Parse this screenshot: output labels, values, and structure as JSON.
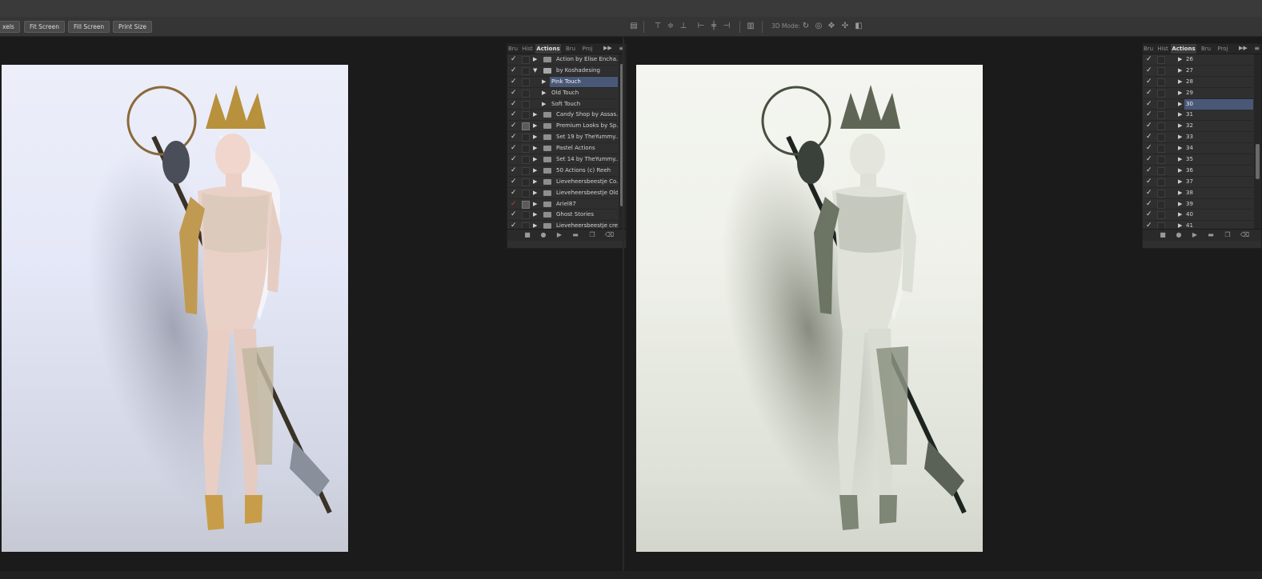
{
  "optionsbar": {
    "buttons": [
      "xels",
      "Fit Screen",
      "Fill Screen",
      "Print Size"
    ],
    "mode_label": "3D Mode:",
    "icons": [
      "auto-align-icon",
      "align-top-icon",
      "align-vcenter-icon",
      "align-bottom-icon",
      "align-left-icon",
      "align-hcenter-icon",
      "align-right-icon",
      "distribute-icon",
      "3d-rotate-icon",
      "3d-roll-icon",
      "3d-pan-icon",
      "3d-slide-icon",
      "3d-scale-icon"
    ]
  },
  "panel_left": {
    "tabs": [
      "Bru",
      "Hist",
      "Actions",
      "Bru",
      "Proj"
    ],
    "active_tab": "Actions",
    "rows": [
      {
        "label": "Action by Elise Encha...",
        "level": 0,
        "expanded": false,
        "folder": true,
        "check": "on",
        "dialog": false,
        "selected": false
      },
      {
        "label": "by Koshadesing",
        "level": 0,
        "expanded": true,
        "folder": true,
        "check": "on",
        "dialog": false,
        "selected": false
      },
      {
        "label": "Pink Touch",
        "level": 1,
        "expanded": false,
        "folder": false,
        "check": "on",
        "dialog": false,
        "selected": true
      },
      {
        "label": "Old Touch",
        "level": 1,
        "expanded": false,
        "folder": false,
        "check": "on",
        "dialog": false,
        "selected": false
      },
      {
        "label": "Soft Touch",
        "level": 1,
        "expanded": false,
        "folder": false,
        "check": "on",
        "dialog": false,
        "selected": false
      },
      {
        "label": "Candy Shop by Assas...",
        "level": 0,
        "expanded": false,
        "folder": true,
        "check": "on",
        "dialog": false,
        "selected": false
      },
      {
        "label": "Premium Looks by Sp...",
        "level": 0,
        "expanded": false,
        "folder": true,
        "check": "on",
        "dialog": true,
        "selected": false
      },
      {
        "label": "Set 19 by TheYummy...",
        "level": 0,
        "expanded": false,
        "folder": true,
        "check": "on",
        "dialog": false,
        "selected": false
      },
      {
        "label": "Pastel Actions",
        "level": 0,
        "expanded": false,
        "folder": true,
        "check": "on",
        "dialog": false,
        "selected": false
      },
      {
        "label": "Set 14 by TheYummy...",
        "level": 0,
        "expanded": false,
        "folder": true,
        "check": "on",
        "dialog": false,
        "selected": false
      },
      {
        "label": "50 Actions (c) Reeh",
        "level": 0,
        "expanded": false,
        "folder": true,
        "check": "on",
        "dialog": false,
        "selected": false
      },
      {
        "label": "Lieveheersbeestje Co...",
        "level": 0,
        "expanded": false,
        "folder": true,
        "check": "on",
        "dialog": false,
        "selected": false
      },
      {
        "label": "Lieveheersbeestje Old...",
        "level": 0,
        "expanded": false,
        "folder": true,
        "check": "on",
        "dialog": false,
        "selected": false
      },
      {
        "label": "Ariel87",
        "level": 0,
        "expanded": false,
        "folder": true,
        "check": "red",
        "dialog": true,
        "selected": false
      },
      {
        "label": "Ghost Stories",
        "level": 0,
        "expanded": false,
        "folder": true,
        "check": "on",
        "dialog": false,
        "selected": false
      },
      {
        "label": "Lieveheersbeestje cre...",
        "level": 0,
        "expanded": false,
        "folder": true,
        "check": "on",
        "dialog": false,
        "selected": false
      }
    ],
    "footer_icons": [
      "stop-icon",
      "record-icon",
      "play-icon",
      "new-set-icon",
      "new-action-icon",
      "delete-icon"
    ]
  },
  "panel_right": {
    "tabs": [
      "Bru",
      "Hist",
      "Actions",
      "Bru",
      "Proj"
    ],
    "active_tab": "Actions",
    "rows": [
      {
        "label": "26",
        "selected": false
      },
      {
        "label": "27",
        "selected": false
      },
      {
        "label": "28",
        "selected": false
      },
      {
        "label": "29",
        "selected": false
      },
      {
        "label": "30",
        "selected": true
      },
      {
        "label": "31",
        "selected": false
      },
      {
        "label": "32",
        "selected": false
      },
      {
        "label": "33",
        "selected": false
      },
      {
        "label": "34",
        "selected": false
      },
      {
        "label": "35",
        "selected": false
      },
      {
        "label": "36",
        "selected": false
      },
      {
        "label": "37",
        "selected": false
      },
      {
        "label": "38",
        "selected": false
      },
      {
        "label": "39",
        "selected": false
      },
      {
        "label": "40",
        "selected": false
      },
      {
        "label": "41",
        "selected": false
      }
    ],
    "footer_icons": [
      "stop-icon",
      "record-icon",
      "play-icon",
      "new-set-icon",
      "new-action-icon",
      "delete-icon"
    ]
  }
}
